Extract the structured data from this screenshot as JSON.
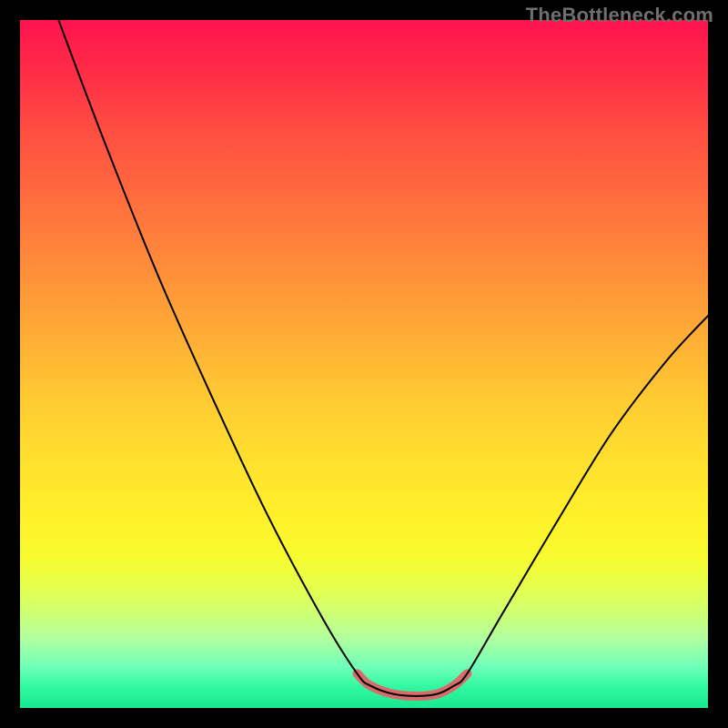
{
  "watermark": "TheBottleneck.com",
  "chart_data": {
    "type": "line",
    "title": "",
    "xlabel": "",
    "ylabel": "",
    "xlim": [
      0,
      100
    ],
    "ylim": [
      0,
      100
    ],
    "grid": false,
    "series": [
      {
        "name": "curve",
        "stroke": "#000000",
        "stroke_width": 2,
        "points": [
          {
            "x": 5.6,
            "y": 100.0
          },
          {
            "x": 12.0,
            "y": 83.0
          },
          {
            "x": 20.0,
            "y": 63.0
          },
          {
            "x": 28.0,
            "y": 45.0
          },
          {
            "x": 36.0,
            "y": 28.0
          },
          {
            "x": 44.0,
            "y": 13.0
          },
          {
            "x": 49.0,
            "y": 5.0
          },
          {
            "x": 51.0,
            "y": 3.2
          },
          {
            "x": 55.0,
            "y": 1.9
          },
          {
            "x": 60.0,
            "y": 1.9
          },
          {
            "x": 63.0,
            "y": 3.2
          },
          {
            "x": 65.0,
            "y": 5.0
          },
          {
            "x": 70.0,
            "y": 13.5
          },
          {
            "x": 78.0,
            "y": 27.0
          },
          {
            "x": 86.0,
            "y": 40.0
          },
          {
            "x": 94.0,
            "y": 50.5
          },
          {
            "x": 100.0,
            "y": 57.0
          }
        ]
      },
      {
        "name": "highlight-trough",
        "stroke": "#d96b6b",
        "stroke_width": 10,
        "points": [
          {
            "x": 49.0,
            "y": 5.0
          },
          {
            "x": 51.0,
            "y": 3.2
          },
          {
            "x": 55.0,
            "y": 1.9
          },
          {
            "x": 60.0,
            "y": 1.9
          },
          {
            "x": 63.0,
            "y": 3.2
          },
          {
            "x": 65.0,
            "y": 5.0
          }
        ]
      }
    ],
    "background_gradient": {
      "top": "#ff1450",
      "mid": "#ffe22e",
      "bottom": "#18e890"
    }
  }
}
